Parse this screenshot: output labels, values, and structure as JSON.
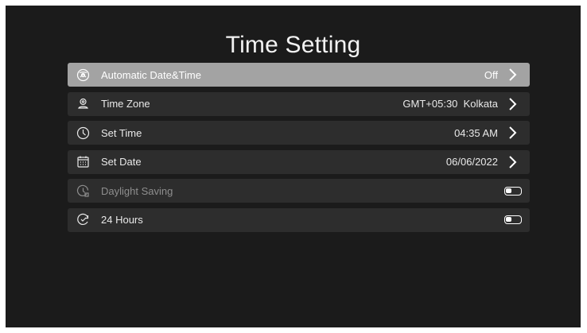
{
  "page": {
    "title": "Time Setting"
  },
  "settings": {
    "items": [
      {
        "label": "Automatic Date&Time",
        "value": "Off",
        "icon": "auto-time-icon",
        "state": "selected"
      },
      {
        "label": "Time Zone",
        "value": "GMT+05:30  Kolkata",
        "icon": "timezone-pin-icon",
        "state": "normal"
      },
      {
        "label": "Set Time",
        "value": "04:35 AM",
        "icon": "clock-icon",
        "state": "normal"
      },
      {
        "label": "Set Date",
        "value": "06/06/2022",
        "icon": "calendar-icon",
        "state": "normal"
      },
      {
        "label": "Daylight Saving",
        "icon": "daylight-saving-icon",
        "state": "disabled",
        "toggle": "off"
      },
      {
        "label": "24 Hours",
        "icon": "clock-24-icon",
        "state": "normal",
        "toggle": "off"
      }
    ]
  },
  "colors": {
    "background": "#1b1b1b",
    "row": "#2d2d2d",
    "row_selected": "#a3a3a3",
    "text": "#e9e9e9",
    "text_disabled": "#8e8e8e"
  }
}
